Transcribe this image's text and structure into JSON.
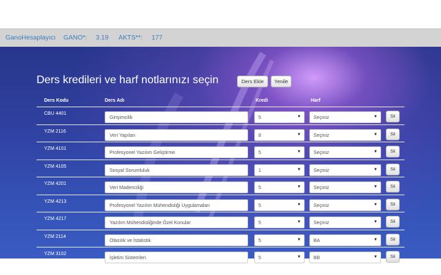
{
  "topbar": {
    "brand": "GanoHesaplayıcı",
    "gano_label": "GANO*:",
    "gano_value": "3.19",
    "akts_label": "AKTS**:",
    "akts_value": "177"
  },
  "title": "Ders kredileri ve harf notlarınızı seçin",
  "buttons": {
    "add": "Ders Ekle",
    "reset": "Yenile"
  },
  "headers": {
    "code": "Ders Kodu",
    "name": "Ders Adı",
    "credit": "Kredi",
    "grade": "Harf"
  },
  "delete_label": "Sil",
  "dropdown_arrow": "▼",
  "rows": [
    {
      "code": "CBU 4401",
      "name": "Girişimcilik",
      "credit": "5",
      "grade": "Seçiniz"
    },
    {
      "code": "YZM 2116",
      "name": "Veri Yapıları",
      "credit": "8",
      "grade": "Seçiniz"
    },
    {
      "code": "YZM 4101",
      "name": "Profesyonel Yazılım Geliştirme",
      "credit": "5",
      "grade": "Seçiniz"
    },
    {
      "code": "YZM 4105",
      "name": "Sosyal Sorumluluk",
      "credit": "1",
      "grade": "Seçiniz"
    },
    {
      "code": "YZM 4201",
      "name": "Veri Madenciliği",
      "credit": "5",
      "grade": "Seçiniz"
    },
    {
      "code": "YZM 4213",
      "name": "Profesyonel Yazılım Mühendisliği Uygulamaları",
      "credit": "5",
      "grade": "Seçiniz"
    },
    {
      "code": "YZM 4217",
      "name": "Yazılım Mühendisliğinde Özel Konular",
      "credit": "5",
      "grade": "Seçiniz"
    },
    {
      "code": "YZM 2114",
      "name": "Olasılık ve İstatistik",
      "credit": "5",
      "grade": "BA"
    },
    {
      "code": "YZM 3102",
      "name": "İşletim Sistemleri",
      "credit": "5",
      "grade": "BB"
    }
  ]
}
